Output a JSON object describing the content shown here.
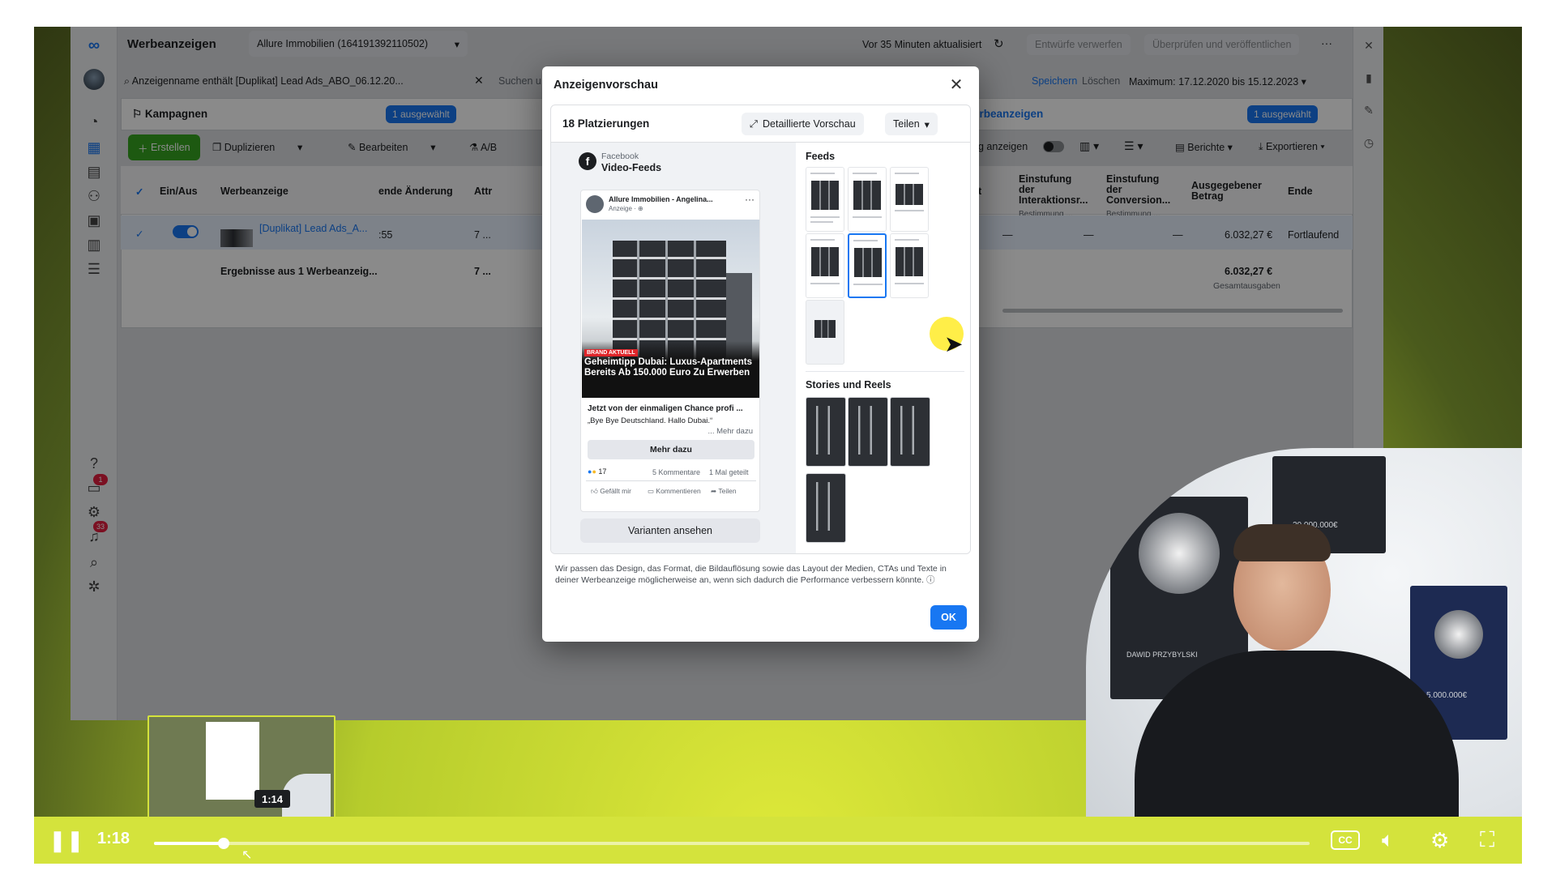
{
  "app": {
    "title": "Werbeanzeigen",
    "account": "Allure Immobilien (164191392110502)",
    "updated": "Vor 35 Minuten aktualisiert",
    "discard": "Entwürfe verwerfen",
    "review": "Überprüfen und veröffentlichen",
    "more": "···"
  },
  "filter": {
    "text": "Anzeigenname enthält [Duplikat] Lead Ads_ABO_06.12.20...",
    "search": "Suchen u",
    "save": "Speichern",
    "delete": "Löschen",
    "date": "Maximum: 17.12.2020 bis 15.12.2023"
  },
  "tabs": {
    "campaigns": "Kampagnen",
    "selected": "1 ausgewählt",
    "ads": "Werbeanzeigen",
    "ads_selected": "1 ausgewählt"
  },
  "toolbar": {
    "create": "Erstellen",
    "duplicate": "Duplizieren",
    "edit": "Bearbeiten",
    "ab": "A/B",
    "show": "g anzeigen",
    "reports": "Berichte",
    "export": "Exportieren"
  },
  "table": {
    "headers": {
      "onoff": "Ein/Aus",
      "ad": "Werbeanzeige",
      "change": "ende Änderung",
      "attr": "Attr",
      "sev": "t",
      "interaction": "Einstufung der Interaktionsr...",
      "interaction_sub": "Bestimmung ...",
      "conversion": "Einstufung der Conversion...",
      "conversion_sub": "Bestimmung ...",
      "spent": "Ausgegebener Betrag",
      "end": "Ende"
    },
    "row": {
      "name": "[Duplikat] Lead Ads_A...",
      "change": ":55",
      "attr": "7 ...",
      "dash1": "—",
      "dash2": "—",
      "dash3": "—",
      "spent": "6.032,27 €",
      "end": "Fortlaufend"
    },
    "summary": {
      "label": "Ergebnisse aus 1 Werbeanzeig...",
      "attr": "7 ...",
      "spent": "6.032,27 €",
      "spent_sub": "Gesamtausgaben"
    }
  },
  "sidebar": {
    "badge1": "1",
    "badge2": "33"
  },
  "modal": {
    "title": "Anzeigenvorschau",
    "placements": "18 Platzierungen",
    "detail": "Detaillierte Vorschau",
    "share": "Teilen",
    "platform": "Facebook",
    "placement": "Video-Feeds",
    "post": {
      "page": "Allure Immobilien - Angelina...",
      "sponsored": "Anzeige · ⊕",
      "badge": "BRAND AKTUELL",
      "headline": "Geheimtipp Dubai: Luxus-Apartments Bereits Ab 150.000 Euro Zu Erwerben",
      "text1": "Jetzt von der einmaligen Chance profi ...",
      "text2": "„Bye Bye Deutschland. Hallo Dubai.“",
      "more": "... Mehr dazu",
      "cta": "Mehr dazu",
      "reactions": "17",
      "comments": "5 Kommentare",
      "shares": "1 Mal geteilt",
      "like": "Gefällt mir",
      "comment": "Kommentieren",
      "share": "Teilen"
    },
    "variants": "Varianten ansehen",
    "feeds": "Feeds",
    "stories": "Stories und Reels",
    "note": "Wir passen das Design, das Format, die Bildauflösung sowie das Layout der Medien, CTAs und Texte in deiner Werbeanzeige möglicherweise an, wenn sich dadurch die Performance verbessern könnte.",
    "ok": "OK"
  },
  "cam": {
    "plaque1": "DAWID PRZYBYLSKI",
    "plaque2": "5.000.000€",
    "plaque3": "20.000.000€"
  },
  "player": {
    "time": "1:18",
    "preview_time": "1:14",
    "progress": 0.06,
    "buffered": 0.06
  },
  "colors": {
    "accent": "#1877f2",
    "player": "#d4e33c",
    "cta_green": "#36a420"
  }
}
